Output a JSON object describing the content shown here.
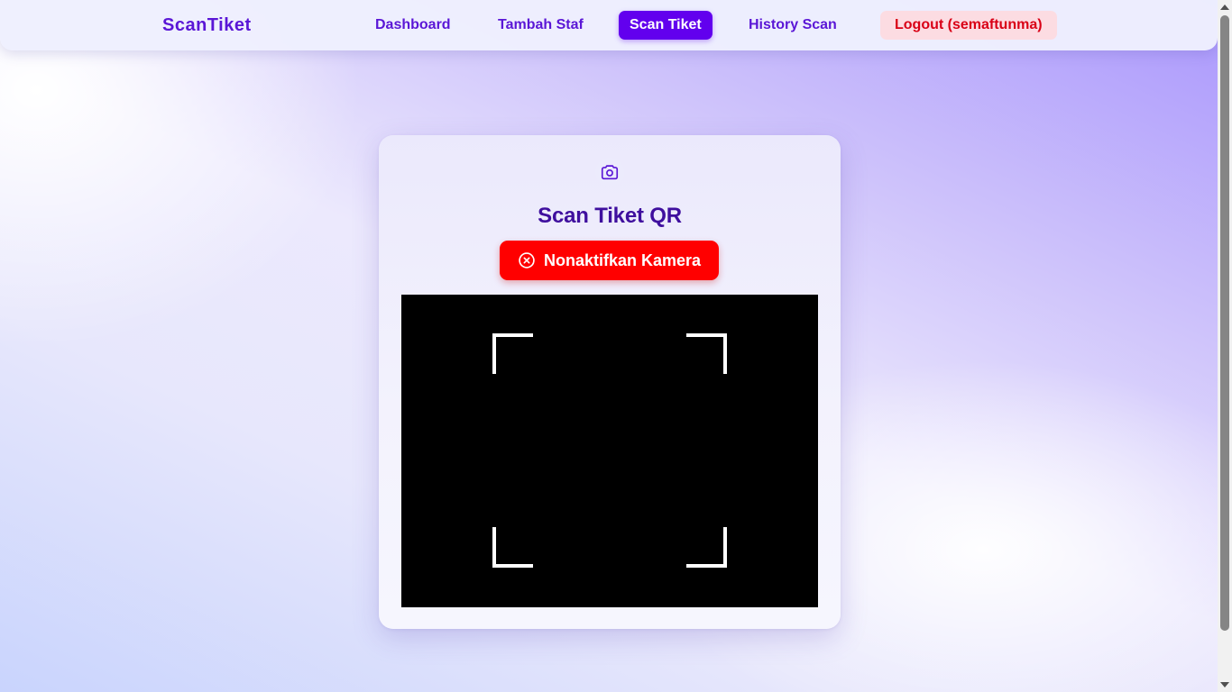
{
  "navbar": {
    "brand": "ScanTiket",
    "links": [
      {
        "label": "Dashboard",
        "active": false
      },
      {
        "label": "Tambah Staf",
        "active": false
      },
      {
        "label": "Scan Tiket",
        "active": true
      },
      {
        "label": "History Scan",
        "active": false
      }
    ],
    "logout_label": "Logout (semaftunma)"
  },
  "card": {
    "icon": "camera-icon",
    "title": "Scan Tiket QR",
    "toggle_camera_button": {
      "label": "Nonaktifkan Kamera",
      "icon": "close-circle-icon"
    },
    "scanner": {
      "camera_active": true
    }
  },
  "colors": {
    "brand": "#5a16d6",
    "active_nav": "#6200ee",
    "title": "#3f0f9e",
    "danger_button": "#ff0000",
    "logout_bg": "#fcdce2",
    "logout_text": "#d90016"
  }
}
